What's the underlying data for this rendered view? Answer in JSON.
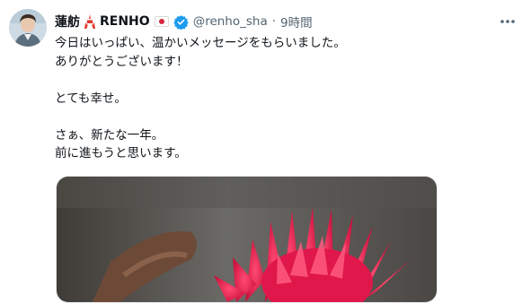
{
  "tweet": {
    "display_name": "蓮舫",
    "name_suffix": "RENHO",
    "handle": "@renho_sha",
    "separator": "·",
    "time": "9時間",
    "text_lines": [
      "今日はいっぱい、温かいメッセージをもらいました。",
      "ありがとうございます！",
      "",
      "とても幸せ。",
      "",
      "さぁ、新たな一年。",
      "前に進もうと思います。"
    ],
    "icons": {
      "tower": "tokyo-tower-icon",
      "flag": "japan-flag-icon",
      "verified": "verified-badge-icon",
      "more": "more-options-icon"
    },
    "colors": {
      "verified": "#1d9bf0",
      "secondary_text": "#536471",
      "flower": "#e0174a"
    }
  }
}
